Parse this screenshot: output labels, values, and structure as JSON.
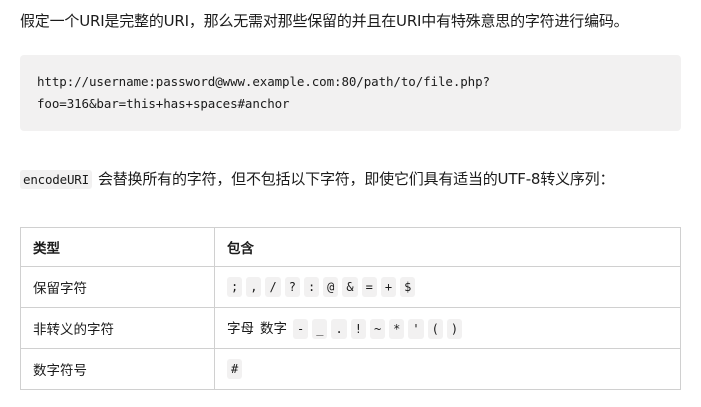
{
  "intro_text": "假定一个URI是完整的URI，那么无需对那些保留的并且在URI中有特殊意思的字符进行编码。",
  "code_block": {
    "line1": "http://username:password@www.example.com:80/path/to/file.php?",
    "line2": "foo=316&bar=this+has+spaces#anchor"
  },
  "description": {
    "code": "encodeURI",
    "text": "会替换所有的字符，但不包括以下字符，即使它们具有适当的UTF-8转义序列："
  },
  "table": {
    "headers": [
      "类型",
      "包含"
    ],
    "rows": [
      {
        "type": "保留字符",
        "plain": [],
        "chars": [
          ";",
          ",",
          "/",
          "?",
          ":",
          "@",
          "&",
          "=",
          "+",
          "$"
        ]
      },
      {
        "type": "非转义的字符",
        "plain": [
          "字母",
          "数字"
        ],
        "chars": [
          "-",
          "_",
          ".",
          "!",
          "~",
          "*",
          "'",
          "(",
          ")"
        ]
      },
      {
        "type": "数字符号",
        "plain": [],
        "chars": [
          "#"
        ]
      }
    ]
  }
}
